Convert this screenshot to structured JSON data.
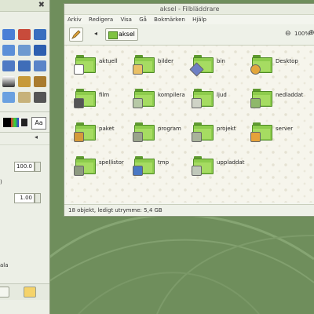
{
  "toolbox": {
    "close_label": "✖",
    "aa_label": "Aa",
    "opacity_value": "100.0",
    "spin_value": "1.00",
    "side_text_1": ")",
    "side_text_2": "ala",
    "colors": {
      "fg": "#000000",
      "bg": "#ffffff"
    }
  },
  "file_manager": {
    "title": "aksel - Filbläddrare",
    "menu": [
      "Arkiv",
      "Redigera",
      "Visa",
      "Gå",
      "Bokmärken",
      "Hjälp"
    ],
    "path_label": "aksel",
    "zoom_label": "100%",
    "items": [
      {
        "label": "aktuell",
        "emblem": "document-icon"
      },
      {
        "label": "bilder",
        "emblem": "image-icon"
      },
      {
        "label": "bin",
        "emblem": "diamond-icon"
      },
      {
        "label": "Desktop",
        "emblem": "desktop-icon"
      },
      {
        "label": "film",
        "emblem": "film-icon"
      },
      {
        "label": "kompilera",
        "emblem": "build-icon"
      },
      {
        "label": "ljud",
        "emblem": "sound-icon"
      },
      {
        "label": "nedladdat",
        "emblem": "download-icon"
      },
      {
        "label": "paket",
        "emblem": "package-icon"
      },
      {
        "label": "program",
        "emblem": "program-icon"
      },
      {
        "label": "projekt",
        "emblem": "project-icon"
      },
      {
        "label": "server",
        "emblem": "lock-icon"
      },
      {
        "label": "spellistor",
        "emblem": "playlist-icon"
      },
      {
        "label": "tmp",
        "emblem": "trash-icon"
      },
      {
        "label": "uppladdat",
        "emblem": "upload-icon"
      }
    ],
    "status": "18 objekt, ledigt utrymme: 5,4 GB"
  }
}
